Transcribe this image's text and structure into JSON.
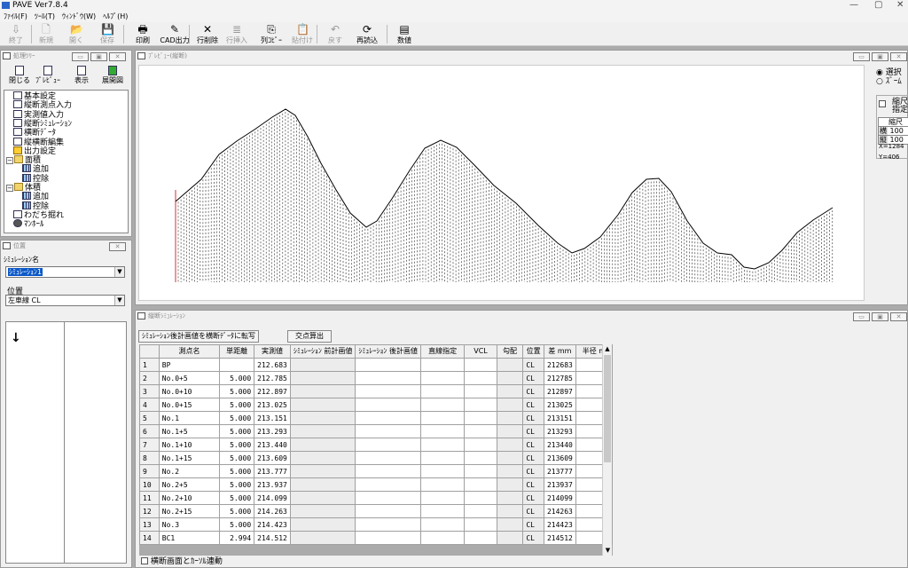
{
  "app": {
    "title": "PAVE Ver7.8.4",
    "minimize": "—",
    "restore": "▢",
    "close": "✕"
  },
  "menu": [
    "ﾌｧｲﾙ(F)",
    "ﾂｰﾙ(T)",
    "ｳｨﾝﾄﾞｳ(W)",
    "ﾍﾙﾌﾟ(H)"
  ],
  "toolbar": [
    {
      "label": "終了",
      "icon": "exit-icon",
      "glyph": "⇩",
      "enabled": false
    },
    {
      "label": "新規",
      "icon": "new-file-icon",
      "glyph": "🗋",
      "enabled": false
    },
    {
      "label": "開く",
      "icon": "open-folder-icon",
      "glyph": "📂",
      "enabled": false
    },
    {
      "label": "保存",
      "icon": "save-icon",
      "glyph": "💾",
      "enabled": false
    },
    {
      "label": "印刷",
      "icon": "print-icon",
      "glyph": "🖶",
      "enabled": true
    },
    {
      "label": "CAD出力",
      "icon": "cad-output-icon",
      "glyph": "✎",
      "enabled": true
    },
    {
      "label": "行削除",
      "icon": "delete-row-icon",
      "glyph": "✕",
      "enabled": true
    },
    {
      "label": "行挿入",
      "icon": "insert-row-icon",
      "glyph": "≣",
      "enabled": false
    },
    {
      "label": "列ｺﾋﾟｰ",
      "icon": "copy-column-icon",
      "glyph": "⎘",
      "enabled": true
    },
    {
      "label": "貼付け",
      "icon": "paste-icon",
      "glyph": "📋",
      "enabled": false
    },
    {
      "label": "戻す",
      "icon": "undo-icon",
      "glyph": "↶",
      "enabled": false
    },
    {
      "label": "再読込",
      "icon": "reload-icon",
      "glyph": "⟳",
      "enabled": true
    },
    {
      "label": "数値",
      "icon": "numeric-icon",
      "glyph": "▤",
      "enabled": true
    }
  ],
  "tree_panel": {
    "title": "処理ﾂﾘｰ",
    "buttons": [
      {
        "label": "閉じる",
        "icon": "close-tree-icon"
      },
      {
        "label": "ﾌﾟﾚﾋﾞｭｰ",
        "icon": "preview-icon"
      },
      {
        "label": "表示",
        "icon": "display-icon"
      },
      {
        "label": "展開図",
        "icon": "development-view-icon"
      }
    ],
    "items": [
      {
        "label": "基本設定",
        "indent": 1,
        "icon": "doc-icon"
      },
      {
        "label": "縦断測点入力",
        "indent": 1,
        "icon": "doc-icon"
      },
      {
        "label": "実測値入力",
        "indent": 1,
        "icon": "doc-icon"
      },
      {
        "label": "縦断ｼﾐｭﾚｰｼｮﾝ",
        "indent": 1,
        "icon": "doc-icon"
      },
      {
        "label": "横断ﾃﾞｰﾀ",
        "indent": 1,
        "icon": "doc-icon"
      },
      {
        "label": "縦横断編集",
        "indent": 1,
        "icon": "doc-icon"
      },
      {
        "label": "出力設定",
        "indent": 1,
        "icon": "output-icon"
      },
      {
        "label": "面積",
        "indent": 0,
        "icon": "folder-icon",
        "toggle": "−"
      },
      {
        "label": "追加",
        "indent": 2,
        "icon": "grid-icon"
      },
      {
        "label": "控除",
        "indent": 2,
        "icon": "grid-icon"
      },
      {
        "label": "体積",
        "indent": 0,
        "icon": "folder-icon",
        "toggle": "−"
      },
      {
        "label": "追加",
        "indent": 2,
        "icon": "grid-icon"
      },
      {
        "label": "控除",
        "indent": 2,
        "icon": "grid-icon"
      },
      {
        "label": "わだち掘れ",
        "indent": 1,
        "icon": "doc-icon"
      },
      {
        "label": "ﾏﾝﾎｰﾙ",
        "indent": 1,
        "icon": "manhole-icon"
      }
    ]
  },
  "position_panel": {
    "title": "位置",
    "sim_label": "ｼﾐｭﾚｰｼｮﾝ名",
    "sim_value": "ｼﾐｭﾚｰｼｮﾝ1",
    "pos_label": "位置",
    "pos_value": "左車線 CL",
    "arrow": "↓"
  },
  "preview_panel": {
    "title": "ﾌﾟﾚﾋﾞｭｰ(縦断)",
    "mode_select": "選択",
    "mode_zoom": "ｽﾞｰﾑ",
    "scale_check": "縮尺",
    "scale_check2": "指定",
    "scale_head": "縮尺",
    "scale_h_label": "横",
    "scale_h": "100",
    "scale_v_label": "縦",
    "scale_v": "100",
    "coord_x": "X=1284",
    "coord_y": "Y=406"
  },
  "table_panel": {
    "title": "縦断ｼﾐｭﾚｰｼｮﾝ",
    "btn_transfer": "ｼﾐｭﾚｰｼｮﾝ後計画値を横断ﾃﾞｰﾀに転写",
    "btn_intersect": "交点算出",
    "headers": [
      "測点名",
      "単距離",
      "実測値",
      "ｼﾐｭﾚｰｼｮﾝ 前計画値",
      "ｼﾐｭﾚｰｼｮﾝ 後計画値",
      "直線指定",
      "VCL",
      "勾配",
      "位置",
      "差 mm",
      "半径 m"
    ],
    "rows": [
      [
        "1",
        "BP",
        "",
        "212.683",
        "CL",
        "212683"
      ],
      [
        "2",
        "No.0+5",
        "5.000",
        "212.785",
        "CL",
        "212785"
      ],
      [
        "3",
        "No.0+10",
        "5.000",
        "212.897",
        "CL",
        "212897"
      ],
      [
        "4",
        "No.0+15",
        "5.000",
        "213.025",
        "CL",
        "213025"
      ],
      [
        "5",
        "No.1",
        "5.000",
        "213.151",
        "CL",
        "213151"
      ],
      [
        "6",
        "No.1+5",
        "5.000",
        "213.293",
        "CL",
        "213293"
      ],
      [
        "7",
        "No.1+10",
        "5.000",
        "213.440",
        "CL",
        "213440"
      ],
      [
        "8",
        "No.1+15",
        "5.000",
        "213.609",
        "CL",
        "213609"
      ],
      [
        "9",
        "No.2",
        "5.000",
        "213.777",
        "CL",
        "213777"
      ],
      [
        "10",
        "No.2+5",
        "5.000",
        "213.937",
        "CL",
        "213937"
      ],
      [
        "11",
        "No.2+10",
        "5.000",
        "214.099",
        "CL",
        "214099"
      ],
      [
        "12",
        "No.2+15",
        "5.000",
        "214.263",
        "CL",
        "214263"
      ],
      [
        "13",
        "No.3",
        "5.000",
        "214.423",
        "CL",
        "214423"
      ],
      [
        "14",
        "BC1",
        "2.994",
        "214.512",
        "CL",
        "214512"
      ]
    ],
    "checkbox_label": "横断画面とｶｰｿﾙ連動"
  }
}
